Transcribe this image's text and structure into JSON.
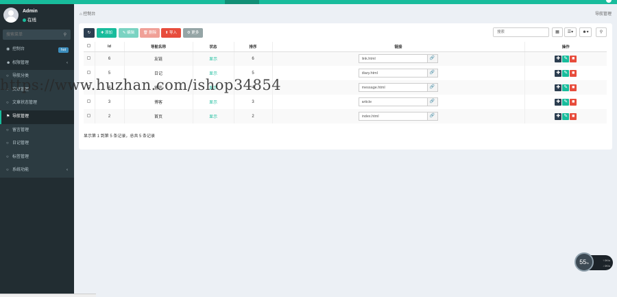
{
  "user": {
    "name": "Admin",
    "status": "在线"
  },
  "sidebar": {
    "search_placeholder": "搜索菜单",
    "items": [
      {
        "label": "控制台",
        "badge": "hot"
      },
      {
        "label": "权限管理",
        "caret": "‹"
      },
      {
        "label": "导航分类"
      },
      {
        "label": "文章管理"
      },
      {
        "label": "文章状态管理"
      },
      {
        "label": "导航管理"
      },
      {
        "label": "留言管理"
      },
      {
        "label": "日记管理"
      },
      {
        "label": "标签管理"
      },
      {
        "label": "系统功能",
        "caret": "‹"
      }
    ]
  },
  "breadcrumb": {
    "left": "控制台",
    "right": "导航管理"
  },
  "toolbar": {
    "add": "✚ 添加",
    "edit": "✎ 编辑",
    "delete": "🗑 删除",
    "import": "⬆ 导入",
    "more": "⚙ 更多",
    "search_placeholder": "搜索"
  },
  "table": {
    "headers": [
      "Id",
      "导航名称",
      "状态",
      "排序",
      "链接",
      "操作"
    ],
    "rows": [
      {
        "id": "6",
        "name": "友链",
        "status": "显示",
        "sort": "6",
        "url": "link.html"
      },
      {
        "id": "5",
        "name": "日记",
        "status": "显示",
        "sort": "5",
        "url": "diary.html"
      },
      {
        "id": "4",
        "name": "留言",
        "status": "显示",
        "sort": "4",
        "url": "message.html"
      },
      {
        "id": "3",
        "name": "博客",
        "status": "显示",
        "sort": "3",
        "url": "article"
      },
      {
        "id": "2",
        "name": "首页",
        "status": "显示",
        "sort": "2",
        "url": "index.html"
      }
    ]
  },
  "pageinfo": "显示第 1 到第 5 条记录，总共 5 条记录",
  "watermark": "https://www.huzhan.com/ishop34854",
  "speed_widget": {
    "value": "55",
    "unit": "%",
    "up": "0K/s",
    "down": "0K/s"
  },
  "colors": {
    "accent": "#18bc9c",
    "sidebar": "#222d32",
    "danger": "#e74c3c",
    "dark": "#2c3e50"
  }
}
